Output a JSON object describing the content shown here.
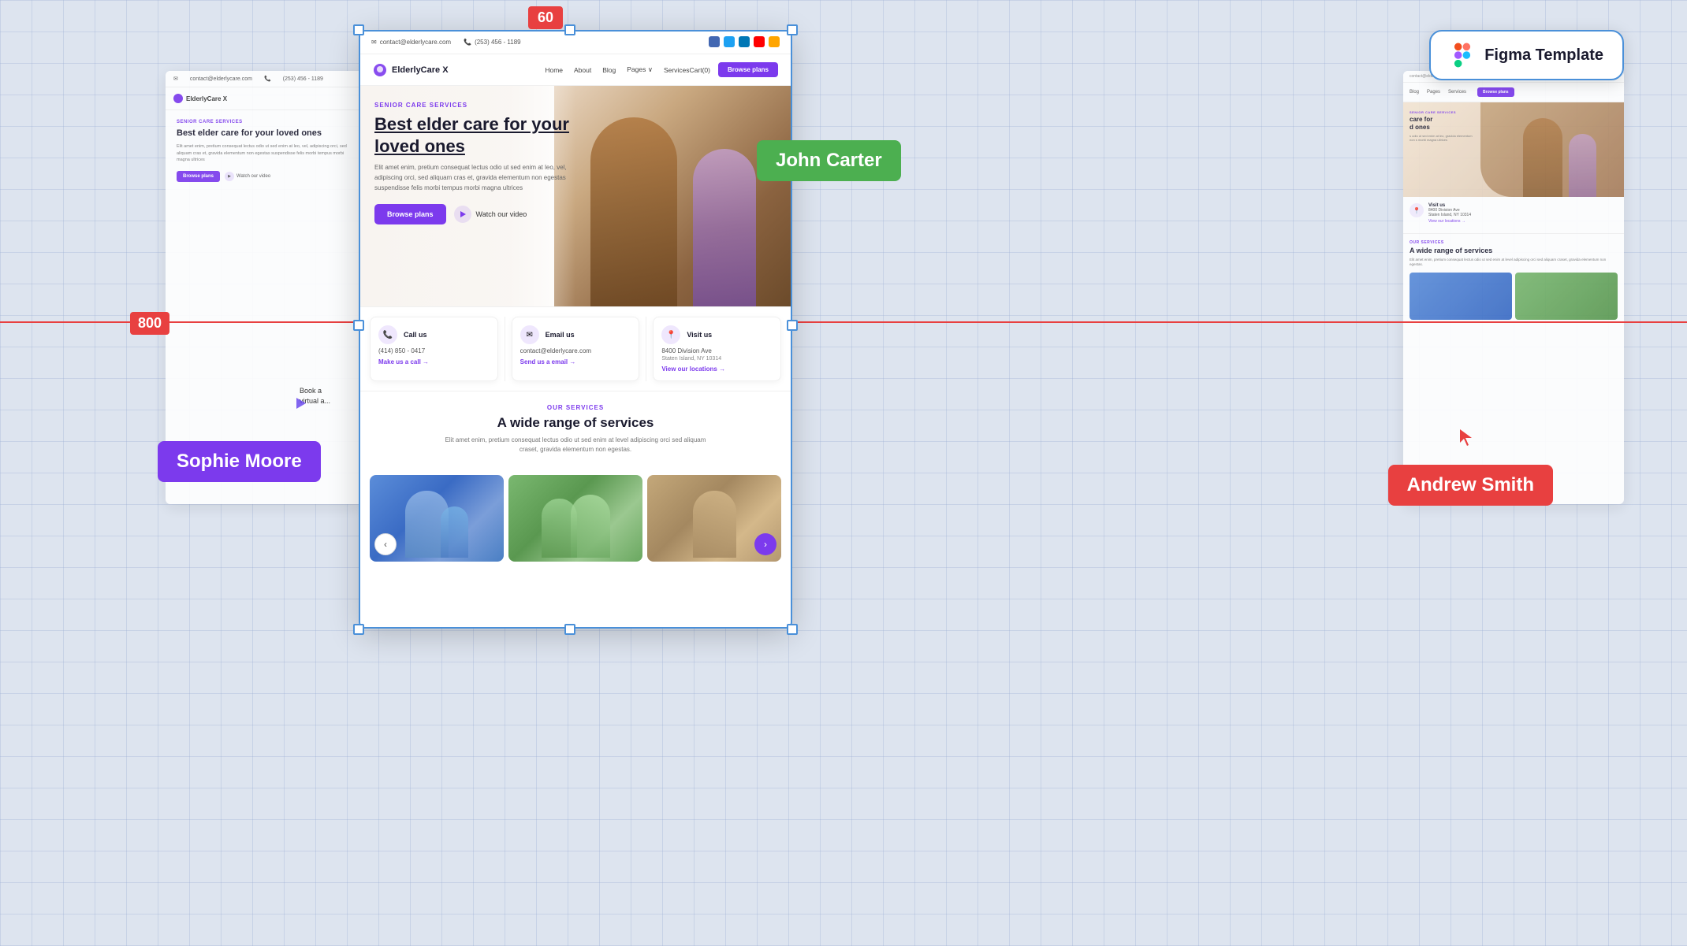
{
  "ruler": {
    "label_60": "60",
    "label_800": "800"
  },
  "figma_badge": {
    "text": "Figma Template"
  },
  "user_labels": {
    "john": "John Carter",
    "sophie": "Sophie Moore",
    "andrew": "Andrew Smith"
  },
  "main_frame": {
    "topbar": {
      "email": "contact@elderlycare.com",
      "phone": "(253) 456 - 1189"
    },
    "nav": {
      "logo": "ElderlyCare X",
      "links": [
        "Home",
        "About",
        "Blog",
        "Pages",
        "Services"
      ],
      "cart": "Cart(0)",
      "cta": "Browse plans"
    },
    "hero": {
      "badge": "SENIOR CARE SERVICES",
      "title": "Best elder care for your loved ones",
      "description": "Elit amet enim, pretium consequat lectus odio ut sed enim at leo, vel, adipiscing orci, sed aliquam cras et, gravida elementum non egestas suspendisse felis morbi tempus morbi magna ultrices",
      "btn_primary": "Browse plans",
      "btn_video": "Watch our video"
    },
    "contact_cards": [
      {
        "icon": "📞",
        "title": "Call us",
        "value": "(414) 850 - 0417",
        "link": "Make us a call →"
      },
      {
        "icon": "✉",
        "title": "Email us",
        "value": "contact@elderlycare.com",
        "link": "Send us a email →"
      },
      {
        "icon": "📍",
        "title": "Visit us",
        "value": "8400 Division Ave",
        "sub": "Staten Island, NY 10314",
        "link": "View our locations →"
      }
    ],
    "services": {
      "badge": "OUR SERVICES",
      "title": "A wide range of services",
      "description": "Elit amet enim, pretium consequat lectus odio ut sed enim at level adipiscing orci sed aliquam craset, gravida elementum non egestas."
    }
  },
  "left_frame": {
    "email": "contact@elderlycare.com",
    "phone": "(253) 456 - 1189",
    "logo": "ElderlyCare X",
    "badge": "SENIOR CARE SERVICES",
    "title": "Best elder care for your loved ones",
    "desc": "Elit amet enim, pretium consequat lectus odio ut sed enim at leo, vel, adipiscing orci, sed aliquam cras et, gravida elementum non egestas suspendisse felis morbi tempus morbi magna ultrices",
    "btn_primary": "Browse plans",
    "btn_video": "Watch our video"
  },
  "right_frame": {
    "nav_links": [
      "Blog",
      "Pages",
      "Services"
    ],
    "btn": "Browse plans",
    "hero_badge": "SENIOR CARE SERVICES",
    "hero_title": "care for d ones",
    "desc": "s odio ut sed enim at leo, gravida elementum non s morbi magna ultrices",
    "contact": {
      "visit_title": "Visit us",
      "visit_addr1": "8400 Division Ave",
      "visit_addr2": "Staten Island, NY 10314",
      "visit_link": "View our locations →"
    },
    "services": {
      "badge": "OUR SERVICES",
      "title": "A wide range of services",
      "desc": "Elit amet enim, pretium consequat lectus odio ut sed enim at level adipiscing orci sed aliquam craset, gravida elementum non egestas."
    }
  },
  "book_panel": {
    "text": "Book a virtual a..."
  }
}
